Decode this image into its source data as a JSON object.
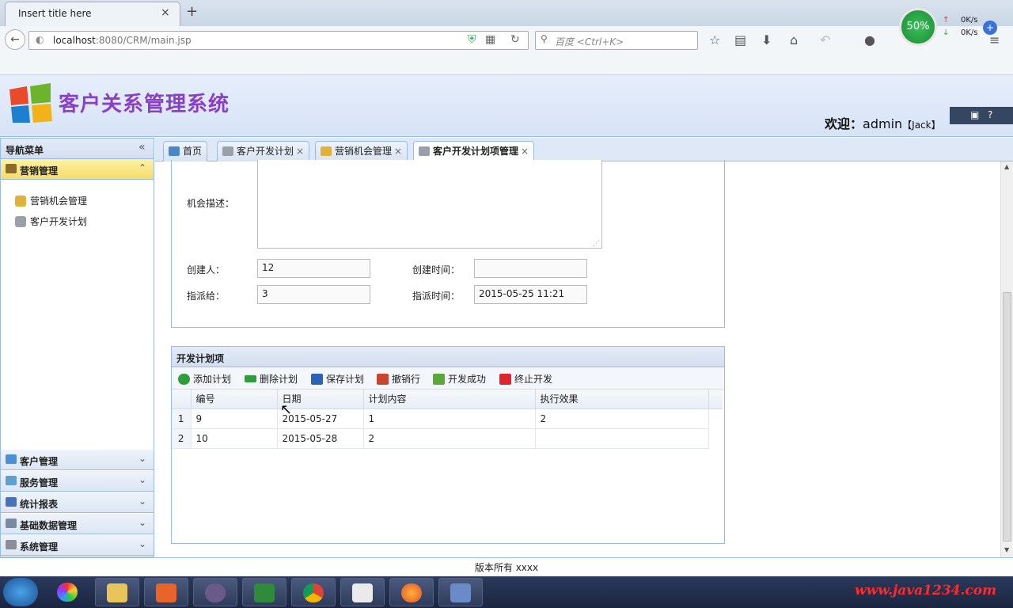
{
  "browser": {
    "tab_title": "Insert title here",
    "tab_close": "×",
    "new_tab": "+",
    "url_host": "localhost",
    "url_rest": ":8080/CRM/main.jsp",
    "search_placeholder": "百度 <Ctrl+K>",
    "speed_percent": "50%",
    "speed_up": "0K/s",
    "speed_down": "0K/s"
  },
  "header": {
    "app_title": "客户关系管理系统",
    "welcome_label": "欢迎：",
    "username": "admin",
    "realname": "【Jack】"
  },
  "sidebar": {
    "title": "导航菜单",
    "collapse": "«",
    "active_section": {
      "label": "营销管理",
      "arrow": "⌃"
    },
    "sub_items": [
      {
        "label": "营销机会管理"
      },
      {
        "label": "客户开发计划"
      }
    ],
    "sections": [
      {
        "label": "客户管理",
        "arrow": "⌄"
      },
      {
        "label": "服务管理",
        "arrow": "⌄"
      },
      {
        "label": "统计报表",
        "arrow": "⌄"
      },
      {
        "label": "基础数据管理",
        "arrow": "⌄"
      },
      {
        "label": "系统管理",
        "arrow": "⌄"
      }
    ]
  },
  "tabs": [
    {
      "label": "首页"
    },
    {
      "label": "客户开发计划",
      "close": "×"
    },
    {
      "label": "营销机会管理",
      "close": "×"
    },
    {
      "label": "客户开发计划项管理",
      "close": "×"
    }
  ],
  "form": {
    "desc_label": "机会描述：",
    "creator_label": "创建人：",
    "creator_value": "12",
    "create_time_label": "创建时间：",
    "create_time_value": "",
    "assignee_label": "指派给：",
    "assignee_value": "3",
    "assign_time_label": "指派时间：",
    "assign_time_value": "2015-05-25 11:21"
  },
  "plan_grid": {
    "title": "开发计划项",
    "toolbar": [
      {
        "label": "添加计划",
        "color": "#2e9e3a"
      },
      {
        "label": "删除计划",
        "color": "#2e9e3a"
      },
      {
        "label": "保存计划",
        "color": "#2a62b8"
      },
      {
        "label": "撤销行",
        "color": "#c8452e"
      },
      {
        "label": "开发成功",
        "color": "#5aa83a"
      },
      {
        "label": "终止开发",
        "color": "#e0242e"
      }
    ],
    "columns": [
      "编号",
      "日期",
      "计划内容",
      "执行效果"
    ],
    "rows": [
      {
        "rownum": "1",
        "id": "9",
        "date": "2015-05-27",
        "content": "1",
        "effect": "2"
      },
      {
        "rownum": "2",
        "id": "10",
        "date": "2015-05-28",
        "content": "2",
        "effect": ""
      }
    ]
  },
  "footer": {
    "text": "版本所有 xxxx"
  },
  "taskbar": {
    "watermark": "www.java1234.com"
  },
  "colors": {
    "accent_border": "#99bbe8",
    "active_section": "#f5dc6a",
    "title_purple": "#8a3fc4"
  }
}
